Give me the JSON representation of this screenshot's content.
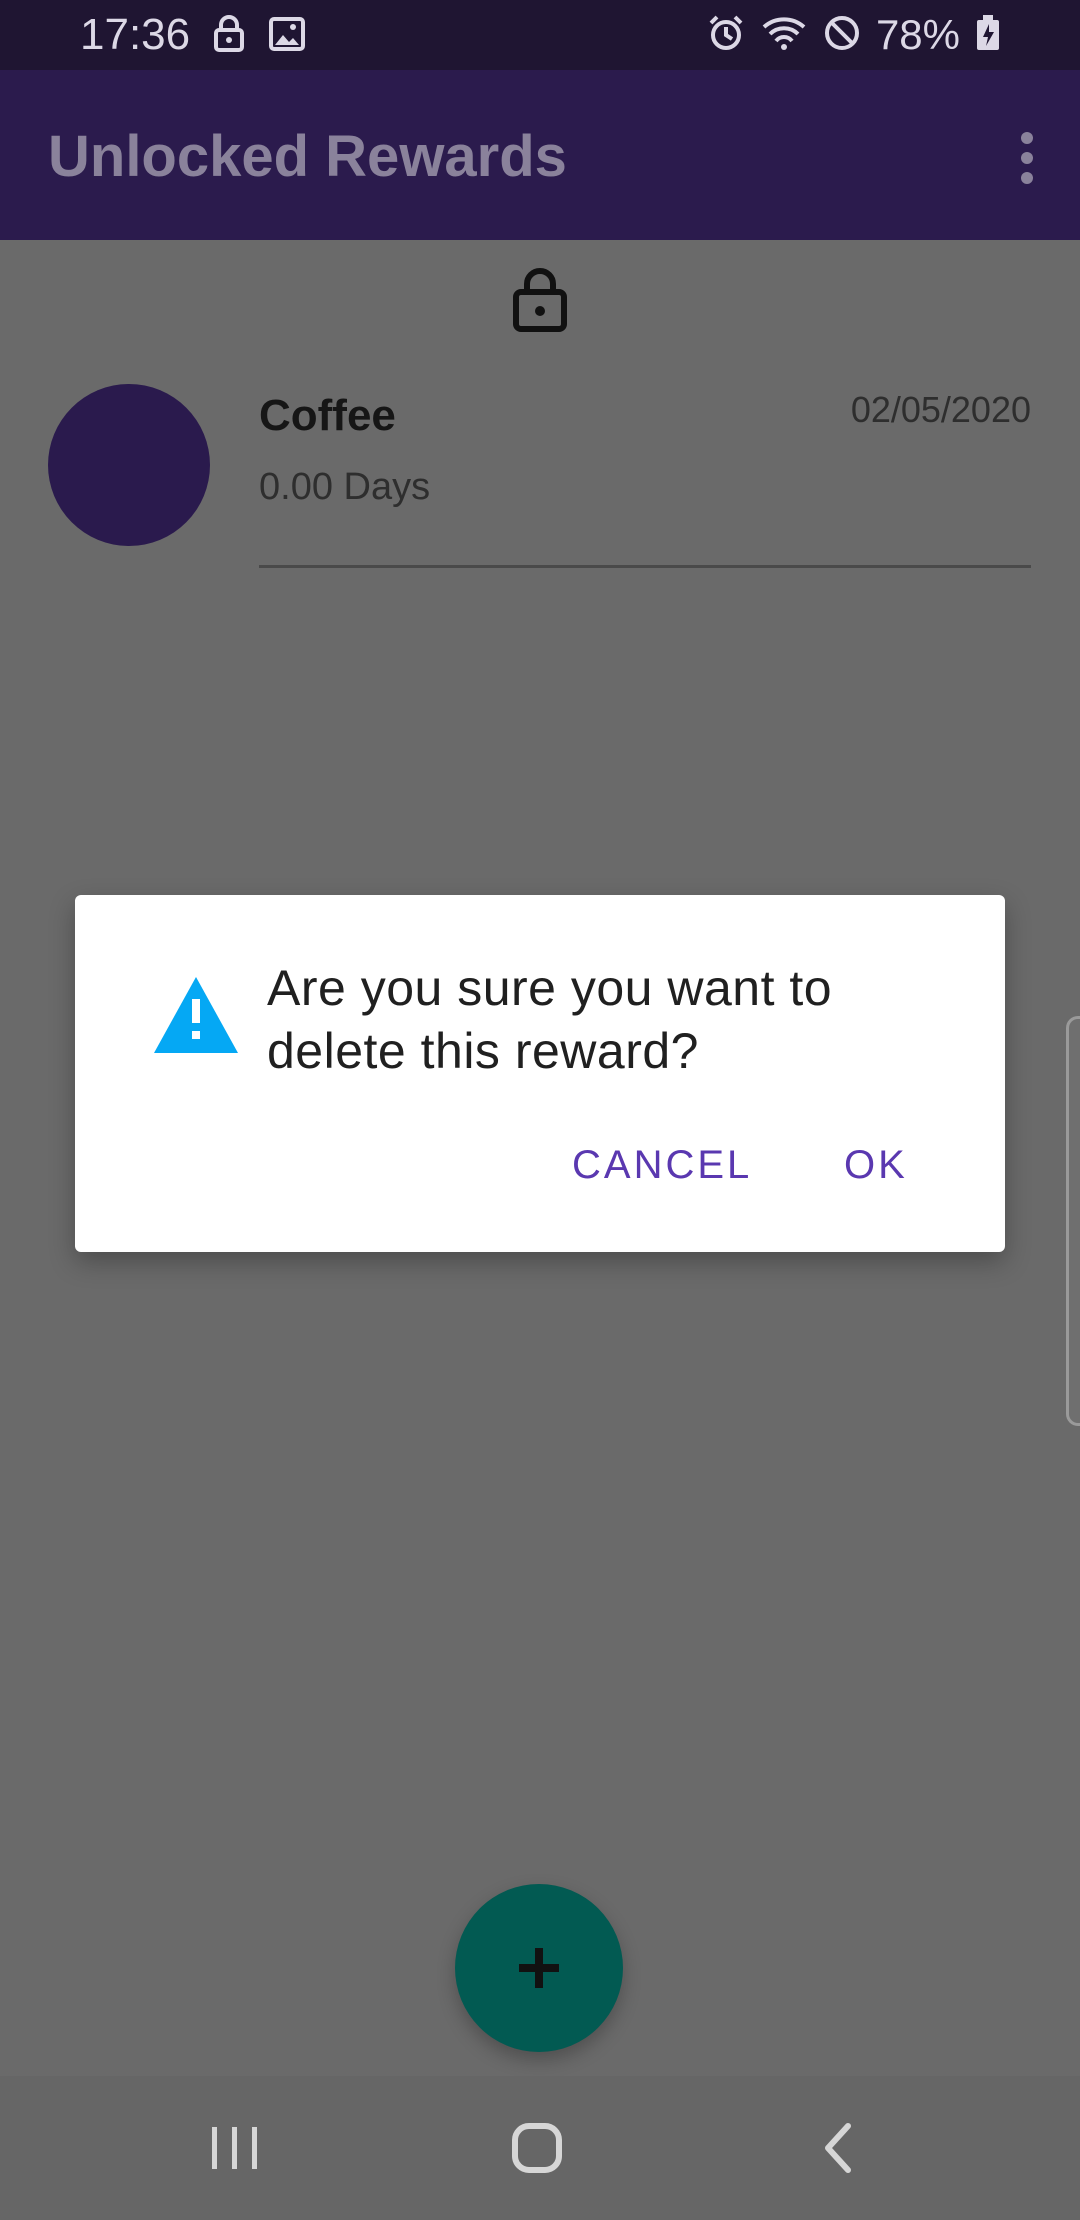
{
  "status_bar": {
    "time": "17:36",
    "battery": "78%",
    "left_icons": [
      "lock-icon",
      "image-icon"
    ],
    "right_icons": [
      "alarm-icon",
      "wifi-icon",
      "do-not-disturb-icon",
      "battery-charging-icon"
    ]
  },
  "app_bar": {
    "title": "Unlocked Rewards",
    "menu_icon": "more-vert-icon"
  },
  "content": {
    "header_icon": "lock-open-icon",
    "rewards": [
      {
        "name": "Coffee",
        "days": "0.00 Days",
        "date": "02/05/2020",
        "avatar_color": "#2a1a4d"
      }
    ]
  },
  "dialog": {
    "icon": "warning-icon",
    "message": "Are you sure you want to delete this reward?",
    "cancel_label": "CANCEL",
    "ok_label": "OK"
  },
  "fab": {
    "icon": "add-icon"
  },
  "nav_bar": {
    "buttons": [
      "recents-icon",
      "home-icon",
      "back-icon"
    ]
  },
  "colors": {
    "status_bar": "#1f1532",
    "app_bar": "#2b1b4d",
    "scrim": "#6a6a6a",
    "dialog_button": "#5a38b0",
    "warning": "#05a8f4",
    "fab": "#025a52"
  }
}
